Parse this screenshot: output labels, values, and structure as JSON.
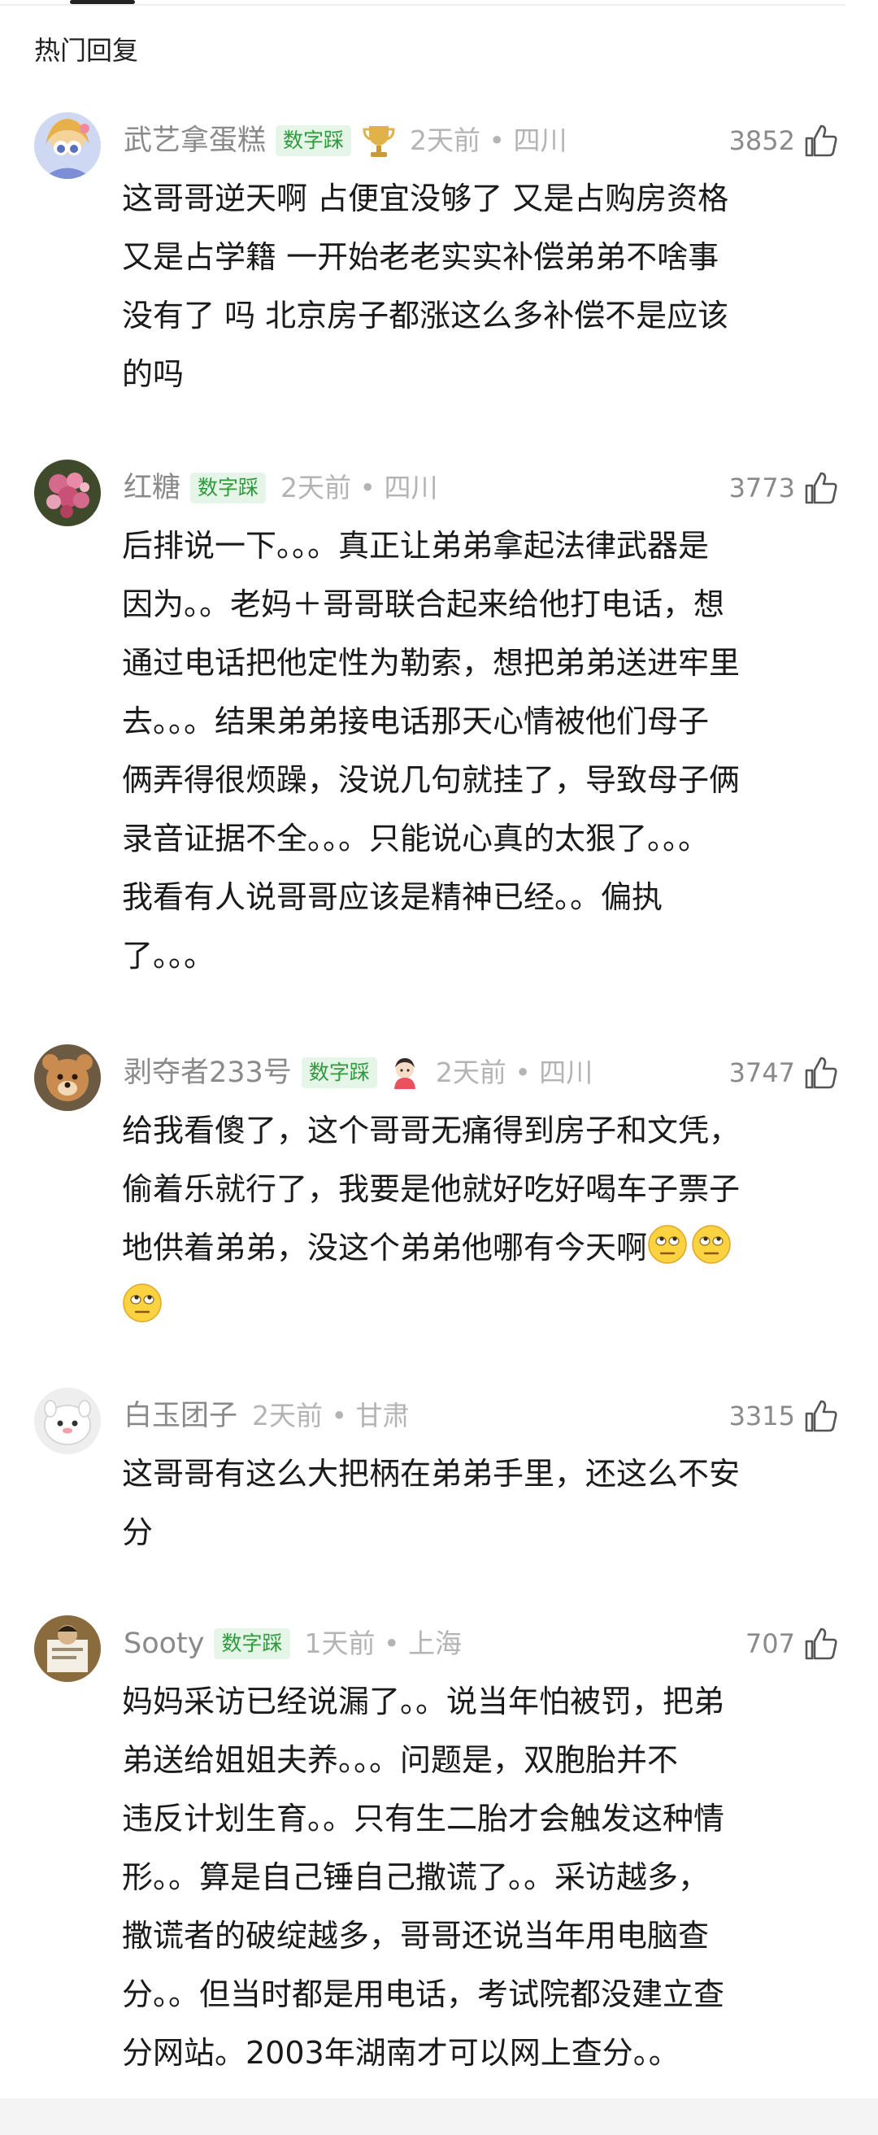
{
  "section": {
    "title": "热门回复"
  },
  "comments": [
    {
      "username": "武艺拿蛋糕",
      "badge": "数字踩",
      "time": "2天前",
      "location": "四川",
      "likes": "3852",
      "lines": [
        "这哥哥逆天啊 占便宜没够了 又是占购房资格",
        "又是占学籍 一开始老老实实补偿弟弟不啥事",
        "没有了 吗 北京房子都涨这么多补偿不是应该",
        "的吗"
      ]
    },
    {
      "username": "红糖",
      "badge": "数字踩",
      "time": "2天前",
      "location": "四川",
      "likes": "3773",
      "lines": [
        "后排说一下。。。真正让弟弟拿起法律武器是",
        "因为。。老妈＋哥哥联合起来给他打电话，想",
        "通过电话把他定性为勒索，想把弟弟送进牢里",
        "去。。。结果弟弟接电话那天心情被他们母子",
        "俩弄得很烦躁，没说几句就挂了，导致母子俩",
        "录音证据不全。。。只能说心真的太狠了。。。",
        "我看有人说哥哥应该是精神已经。。偏执",
        "了。。。"
      ]
    },
    {
      "username": "剥夺者233号",
      "badge": "数字踩",
      "time": "2天前",
      "location": "四川",
      "likes": "3747",
      "lines": [
        "给我看傻了，这个哥哥无痛得到房子和文凭，",
        "偷着乐就行了，我要是他就好吃好喝车子票子",
        "地供着弟弟，没这个弟弟他哪有今天啊"
      ],
      "emoji_names": [
        "eye-roll-emoji",
        "eye-roll-emoji",
        "eye-roll-emoji"
      ]
    },
    {
      "username": "白玉团子",
      "time": "2天前",
      "location": "甘肃",
      "likes": "3315",
      "lines": [
        "这哥哥有这么大把柄在弟弟手里，还这么不安",
        "分"
      ]
    },
    {
      "username": "Sooty",
      "badge": "数字踩",
      "time": "1天前",
      "location": "上海",
      "likes": "707",
      "lines": [
        "妈妈采访已经说漏了。。说当年怕被罚，把弟",
        "弟送给姐姐夫养。。。问题是，双胞胎并不",
        "违反计划生育。。只有生二胎才会触发这种情",
        "形。。算是自己锤自己撒谎了。。采访越多，",
        "撒谎者的破绽越多，哥哥还说当年用电脑查",
        "分。。但当时都是用电话，考试院都没建立查",
        "分网站。2003年湖南才可以网上查分。。"
      ]
    }
  ],
  "meta_separator": "•",
  "colors": {
    "badge_text": "#2e9a3d",
    "badge_bg": "#e5f5e7",
    "meta": "#b4b4b4",
    "name": "#8a8a8a"
  }
}
